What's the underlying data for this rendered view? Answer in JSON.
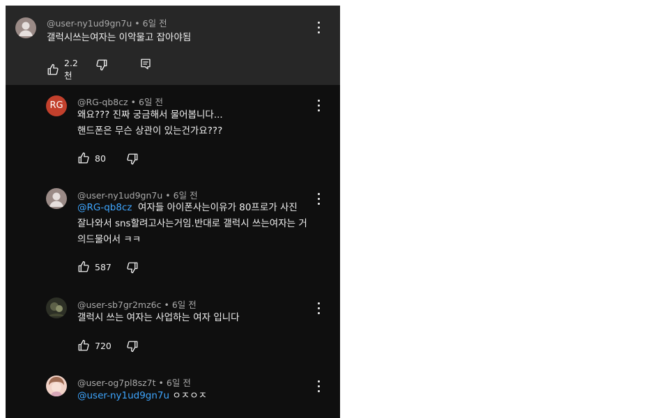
{
  "comments": [
    {
      "author": "@user-ny1ud9gn7u",
      "time": "6일 전",
      "lines": [
        {
          "parts": [
            {
              "text": "갤럭시쓰는여자는 이악물고 잡아야됨"
            }
          ]
        }
      ],
      "likes": "2.2천",
      "avatar_type": "placeholder"
    },
    {
      "author": "@RG-qb8cz",
      "time": "6일 전",
      "lines": [
        {
          "parts": [
            {
              "text": "왜요??? 진짜 궁금해서 물어봅니다..."
            }
          ]
        },
        {
          "parts": [
            {
              "text": "핸드폰은 무슨 상관이 있는건가요???"
            }
          ]
        }
      ],
      "likes": "80",
      "avatar_type": "initials",
      "avatar_text": "RG",
      "avatar_color": "#c2402c"
    },
    {
      "author": "@user-ny1ud9gn7u",
      "time": "6일 전",
      "lines": [
        {
          "parts": [
            {
              "text": "@RG-qb8cz",
              "mention": true
            },
            {
              "text": "  여자들 아이폰사는이유가 80프로가 사진"
            }
          ]
        },
        {
          "parts": [
            {
              "text": "잘나와서 sns할려고사는거임.반대로 갤럭시 쓰는여자는 거"
            }
          ]
        },
        {
          "parts": [
            {
              "text": "의드물어서 ㅋㅋ"
            }
          ]
        }
      ],
      "likes": "587",
      "avatar_type": "placeholder"
    },
    {
      "author": "@user-sb7gr2mz6c",
      "time": "6일 전",
      "lines": [
        {
          "parts": [
            {
              "text": "갤럭시 쓰는 여자는 사업하는 여자 입니다"
            }
          ]
        }
      ],
      "likes": "720",
      "avatar_type": "photo-dark"
    },
    {
      "author": "@user-og7pl8sz7t",
      "time": "6일 전",
      "lines": [
        {
          "parts": [
            {
              "text": "@user-ny1ud9gn7u",
              "mention": true
            },
            {
              "text": " ㅇㅈㅇㅈ"
            }
          ]
        }
      ],
      "likes": "",
      "avatar_type": "photo-anime"
    }
  ],
  "icons": {
    "like": "thumbs-up-icon",
    "dislike": "thumbs-down-icon",
    "reply": "reply-icon",
    "more": "more-vertical-icon"
  },
  "colors": {
    "background": "#0f0f0f",
    "highlight_background": "#272727",
    "text": "#f1f1f1",
    "meta_text": "#aaaaaa",
    "mention": "#3ea6ff"
  }
}
